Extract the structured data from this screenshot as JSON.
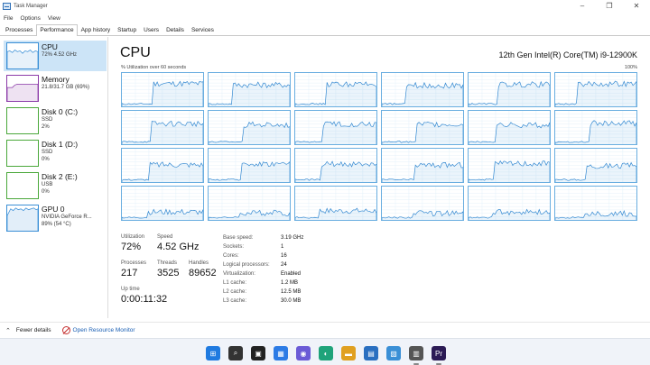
{
  "window": {
    "title": "Task Manager",
    "min": "–",
    "max": "❐",
    "close": "✕"
  },
  "menu": [
    "File",
    "Options",
    "View"
  ],
  "tabs": [
    "Processes",
    "Performance",
    "App history",
    "Startup",
    "Users",
    "Details",
    "Services"
  ],
  "active_tab": "Performance",
  "sidebar": [
    {
      "name": "CPU",
      "sub1": "72% 4.52 GHz",
      "sub2": "",
      "color": "#3a8fd6"
    },
    {
      "name": "Memory",
      "sub1": "21.8/31.7 GB (69%)",
      "sub2": "",
      "color": "#8b3aa8"
    },
    {
      "name": "Disk 0 (C:)",
      "sub1": "SSD",
      "sub2": "2%",
      "color": "#4aa83a"
    },
    {
      "name": "Disk 1 (D:)",
      "sub1": "SSD",
      "sub2": "0%",
      "color": "#4aa83a"
    },
    {
      "name": "Disk 2 (E:)",
      "sub1": "USB",
      "sub2": "0%",
      "color": "#4aa83a"
    },
    {
      "name": "GPU 0",
      "sub1": "NVIDIA GeForce R...",
      "sub2": "89% (54 °C)",
      "color": "#3a8fd6"
    }
  ],
  "main": {
    "title": "CPU",
    "cpu_name": "12th Gen Intel(R) Core(TM) i9-12900K",
    "graph_label": "% Utilization over 60 seconds",
    "graph_max": "100%",
    "core_count": 24,
    "core_levels": [
      0.72,
      0.68,
      0.7,
      0.66,
      0.69,
      0.71,
      0.65,
      0.62,
      0.64,
      0.63,
      0.6,
      0.66,
      0.55,
      0.58,
      0.57,
      0.54,
      0.59,
      0.52,
      0.25,
      0.22,
      0.28,
      0.21,
      0.24,
      0.2
    ]
  },
  "stats": {
    "utilization_label": "Utilization",
    "utilization": "72%",
    "speed_label": "Speed",
    "speed": "4.52 GHz",
    "processes_label": "Processes",
    "processes": "217",
    "threads_label": "Threads",
    "threads": "3525",
    "handles_label": "Handles",
    "handles": "89652",
    "uptime_label": "Up time",
    "uptime": "0:00:11:32"
  },
  "specs": [
    {
      "label": "Base speed:",
      "value": "3.19 GHz"
    },
    {
      "label": "Sockets:",
      "value": "1"
    },
    {
      "label": "Cores:",
      "value": "16"
    },
    {
      "label": "Logical processors:",
      "value": "24"
    },
    {
      "label": "Virtualization:",
      "value": "Enabled"
    },
    {
      "label": "L1 cache:",
      "value": "1.2 MB"
    },
    {
      "label": "L2 cache:",
      "value": "12.5 MB"
    },
    {
      "label": "L3 cache:",
      "value": "30.0 MB"
    }
  ],
  "footer": {
    "fewer_details": "Fewer details",
    "open_resmon": "Open Resource Monitor"
  },
  "taskbar": [
    {
      "name": "windows-start-icon",
      "color": "#1f7ae0",
      "glyph": "⊞"
    },
    {
      "name": "search-icon",
      "color": "#333333",
      "glyph": "⌕"
    },
    {
      "name": "task-view-icon",
      "color": "#222222",
      "glyph": "▣"
    },
    {
      "name": "widgets-icon",
      "color": "#2c7be5",
      "glyph": "▦"
    },
    {
      "name": "chat-icon",
      "color": "#6b5bd6",
      "glyph": "◉"
    },
    {
      "name": "edge-icon",
      "color": "#1fa37a",
      "glyph": "◐"
    },
    {
      "name": "file-explorer-icon",
      "color": "#e0a020",
      "glyph": "▬"
    },
    {
      "name": "store-icon",
      "color": "#2a6fc0",
      "glyph": "▤"
    },
    {
      "name": "task-manager-icon",
      "color": "#3a8fd6",
      "glyph": "▨"
    },
    {
      "name": "photos-icon",
      "color": "#555555",
      "glyph": "▥"
    },
    {
      "name": "premiere-icon",
      "color": "#2b1a55",
      "glyph": "Pr"
    }
  ]
}
